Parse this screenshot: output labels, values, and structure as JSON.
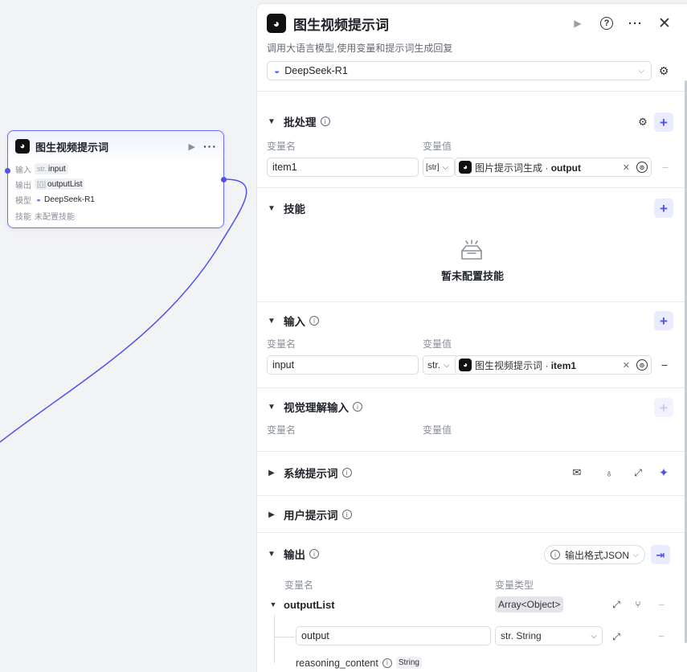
{
  "node": {
    "title": "图生视频提示词",
    "rows": [
      {
        "key": "输入",
        "type": "str.",
        "value": "input"
      },
      {
        "key": "输出",
        "type": "[{}]",
        "value": "outputList"
      },
      {
        "key": "模型",
        "type": "whale",
        "value": "DeepSeek-R1"
      },
      {
        "key": "技能",
        "value": "未配置技能"
      }
    ]
  },
  "panel": {
    "title": "图生视频提示词",
    "description": "调用大语言模型,使用变量和提示词生成回复",
    "model": "DeepSeek-R1",
    "batch": {
      "title": "批处理",
      "col_name": "变量名",
      "col_value": "变量值",
      "row": {
        "name": "item1",
        "type": "[str]",
        "ref_source": "图片提示词生成",
        "ref_var": "output"
      }
    },
    "skills": {
      "title": "技能",
      "empty": "暂未配置技能"
    },
    "input": {
      "title": "输入",
      "col_name": "变量名",
      "col_value": "变量值",
      "row": {
        "name": "input",
        "type": "str.",
        "ref_source": "图生视频提示词",
        "ref_var": "item1"
      }
    },
    "vision": {
      "title": "视觉理解输入",
      "col_name": "变量名",
      "col_value": "变量值"
    },
    "system_prompt": {
      "title": "系统提示词"
    },
    "user_prompt": {
      "title": "用户提示词"
    },
    "output": {
      "title": "输出",
      "format": "输出格式JSON",
      "col_name": "变量名",
      "col_type": "变量类型",
      "list_name": "outputList",
      "list_type": "Array<Object>",
      "child_name": "output",
      "child_type": "str. String",
      "reasoning": "reasoning_content",
      "reasoning_type": "String"
    }
  },
  "colors": {
    "accent": "#4d53e8",
    "accent_bg": "#e9ebfe",
    "edge": "#4d53e8"
  }
}
